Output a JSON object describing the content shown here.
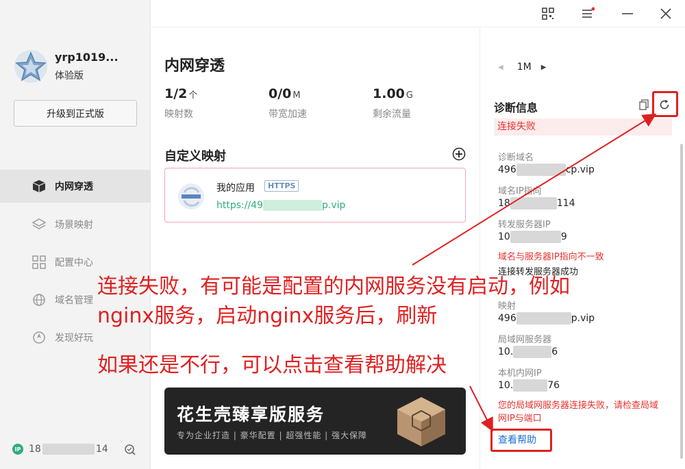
{
  "user": {
    "name": "yrp1019...",
    "version": "体验版",
    "upgrade_label": "升级到正式版"
  },
  "nav": {
    "items": [
      {
        "label": "内网穿透",
        "icon": "cube-icon",
        "active": true
      },
      {
        "label": "场景映射",
        "icon": "map-icon",
        "active": false
      },
      {
        "label": "配置中心",
        "icon": "grid-icon",
        "active": false
      },
      {
        "label": "域名管理",
        "icon": "globe-icon",
        "active": false
      },
      {
        "label": "发现好玩",
        "icon": "compass-icon",
        "active": false
      }
    ]
  },
  "ipbar": {
    "badge": "IP",
    "prefix": "18",
    "suffix": "14"
  },
  "main": {
    "title": "内网穿透",
    "stats": [
      {
        "value": "1/2",
        "unit": "个",
        "label": "映射数"
      },
      {
        "value": "0/0",
        "unit": "M",
        "label": "带宽加速"
      },
      {
        "value": "1.00",
        "unit": "G",
        "label": "剩余流量"
      }
    ],
    "section_title": "自定义映射",
    "mapping": {
      "name": "我的应用",
      "badge": "HTTPS",
      "url_prefix": "https://49",
      "url_suffix": "p.vip"
    },
    "banner": {
      "title": "花生壳臻享版服务",
      "subtitle": "专为企业打造 | 豪华配置 | 超强性能 | 强大保障"
    }
  },
  "diag": {
    "period": "1M",
    "title": "诊断信息",
    "status": "连接失败",
    "fields": [
      {
        "label": "诊断域名",
        "value_prefix": "496",
        "value_suffix": "cp.vip"
      },
      {
        "label": "域名IP指向",
        "value_prefix": "18",
        "value_suffix": "114"
      },
      {
        "label": "转发服务器IP",
        "value_prefix": "10",
        "value_suffix": "9"
      }
    ],
    "warn1": "域名与服务器IP指向不一致",
    "ok1": "连接转发服务器成功",
    "fields2": [
      {
        "label": "映射",
        "value_prefix": "496",
        "value_suffix": "p.vip"
      },
      {
        "label": "局域网服务器",
        "value_prefix": "10.",
        "value_suffix": "6"
      },
      {
        "label": "本机内网IP",
        "value_prefix": "10.",
        "value_suffix": "76"
      }
    ],
    "warn2": "您的局域网服务器连接失败，请检查局域网IP与端口",
    "help": "查看帮助"
  },
  "annotation": {
    "line1": "连接失败，有可能是配置的内网服务没有启动，例如",
    "line2": "nginx服务，启动nginx服务后，刷新",
    "line3": "如果还是不行，可以点击查看帮助解决"
  },
  "colors": {
    "accent_green": "#2fae7c",
    "error_red": "#e6322d",
    "annotation_red": "#e02020",
    "link_blue": "#1a6fd1"
  }
}
